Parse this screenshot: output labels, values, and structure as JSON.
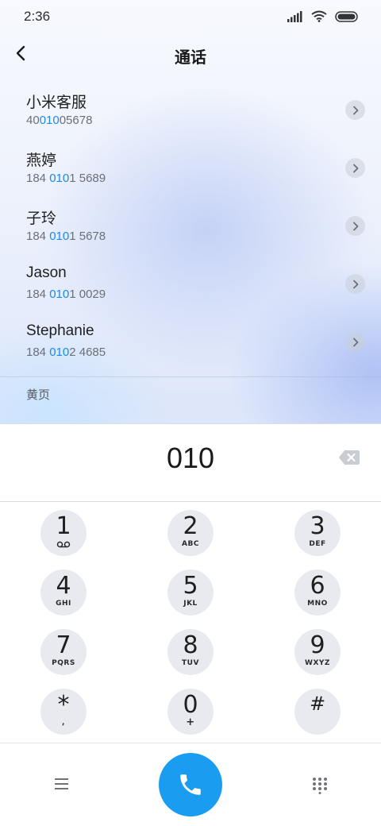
{
  "status_bar": {
    "time": "2:36"
  },
  "header": {
    "title": "通话"
  },
  "contacts": [
    {
      "name": "小米客服",
      "number_parts": [
        "40",
        "010",
        "05678"
      ]
    },
    {
      "name": "燕婷",
      "number_parts": [
        "184 ",
        "010",
        "1 5689"
      ]
    },
    {
      "name": "子玲",
      "number_parts": [
        "184 ",
        "010",
        "1 5678"
      ]
    },
    {
      "name": "Jason",
      "number_parts": [
        "184 ",
        "010",
        "1 0029"
      ]
    },
    {
      "name": "Stephanie",
      "number_parts": [
        "184 ",
        "010",
        "2 4685"
      ]
    }
  ],
  "yellow_pages": {
    "label": "黄页"
  },
  "dialer": {
    "entered_number": "010"
  },
  "keypad": {
    "keys": [
      {
        "digit": "1",
        "letters": ""
      },
      {
        "digit": "2",
        "letters": "ABC"
      },
      {
        "digit": "3",
        "letters": "DEF"
      },
      {
        "digit": "4",
        "letters": "GHI"
      },
      {
        "digit": "5",
        "letters": "JKL"
      },
      {
        "digit": "6",
        "letters": "MNO"
      },
      {
        "digit": "7",
        "letters": "PQRS"
      },
      {
        "digit": "8",
        "letters": "TUV"
      },
      {
        "digit": "9",
        "letters": "WXYZ"
      },
      {
        "digit": "*",
        "letters": ","
      },
      {
        "digit": "0",
        "letters": "+"
      },
      {
        "digit": "#",
        "letters": ""
      }
    ]
  },
  "icons": {
    "back": "chevron-left-icon",
    "backspace": "backspace-icon",
    "menu": "menu-icon",
    "call": "phone-icon",
    "dialpad": "dialpad-icon",
    "voicemail": "voicemail-icon"
  },
  "colors": {
    "accent": "#1a9cf0",
    "highlight": "#1a8be8",
    "key_background": "#e8eaef"
  }
}
